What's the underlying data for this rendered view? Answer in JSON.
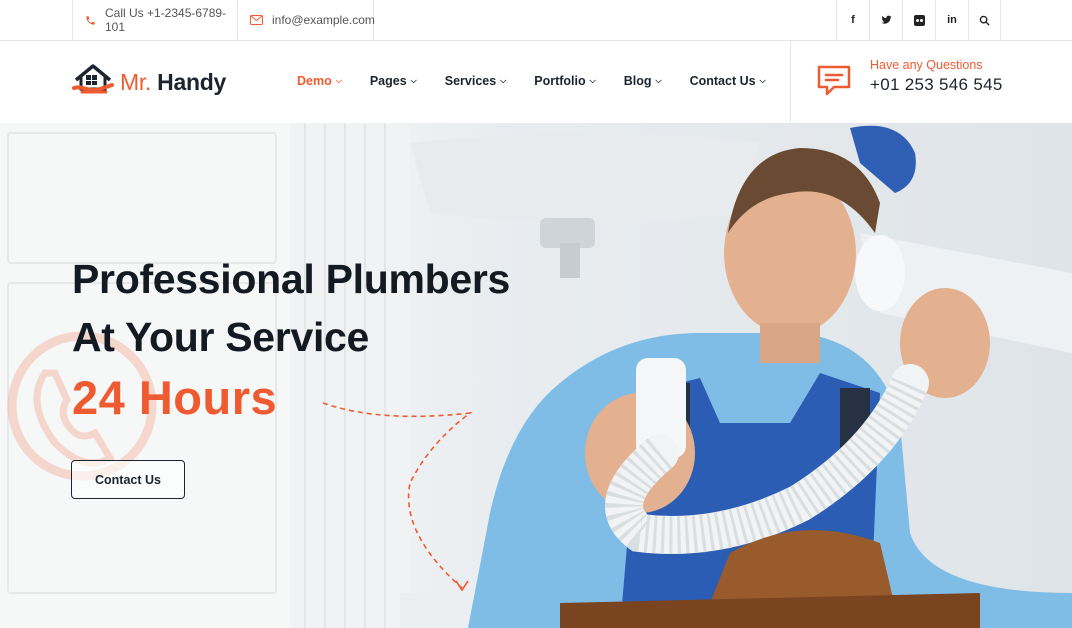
{
  "topbar": {
    "phone": "Call Us +1-2345-6789-101",
    "email": "info@example.com",
    "socials": [
      {
        "icon": "facebook-icon",
        "glyph": "f"
      },
      {
        "icon": "twitter-icon",
        "glyph": "t"
      },
      {
        "icon": "flickr-icon",
        "glyph": "••"
      },
      {
        "icon": "linkedin-icon",
        "glyph": "in"
      },
      {
        "icon": "search-icon",
        "glyph": ""
      }
    ]
  },
  "header": {
    "logo": {
      "mr": "Mr.",
      "handy": "Handy"
    },
    "nav": [
      {
        "label": "Demo",
        "active": true
      },
      {
        "label": "Pages",
        "active": false
      },
      {
        "label": "Services",
        "active": false
      },
      {
        "label": "Portfolio",
        "active": false
      },
      {
        "label": "Blog",
        "active": false
      },
      {
        "label": "Contact Us",
        "active": false
      }
    ],
    "contact": {
      "label": "Have any Questions",
      "phone": "+01 253 546 545"
    }
  },
  "hero": {
    "title_line1": "Professional Plumbers",
    "title_line2": "At Your Service",
    "accent": "24 Hours",
    "button": "Contact Us"
  },
  "colors": {
    "accent": "#ef5b31",
    "dark": "#1d2430",
    "border": "#e6e6e6"
  }
}
